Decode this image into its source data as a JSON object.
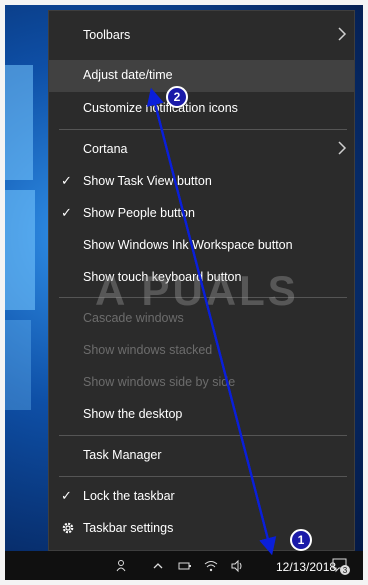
{
  "menu": {
    "items": [
      {
        "label": "Toolbars",
        "submenu": true
      },
      {
        "label": "Adjust date/time",
        "hover": true
      },
      {
        "label": "Customize notification icons"
      },
      {
        "label": "Cortana",
        "submenu": true
      },
      {
        "label": "Show Task View button",
        "checked": true
      },
      {
        "label": "Show People button",
        "checked": true
      },
      {
        "label": "Show Windows Ink Workspace button"
      },
      {
        "label": "Show touch keyboard button"
      },
      {
        "label": "Cascade windows",
        "disabled": true
      },
      {
        "label": "Show windows stacked",
        "disabled": true
      },
      {
        "label": "Show windows side by side",
        "disabled": true
      },
      {
        "label": "Show the desktop"
      },
      {
        "label": "Task Manager"
      },
      {
        "label": "Lock the taskbar",
        "checked": true
      },
      {
        "label": "Taskbar settings",
        "icon": "gear-icon"
      }
    ]
  },
  "taskbar": {
    "clock": "12/13/2018",
    "notification_count": "3",
    "tray_icons": [
      "people-icon",
      "chevron-up-icon",
      "battery-icon",
      "wifi-icon",
      "volume-icon"
    ]
  },
  "watermark": "A PUALS",
  "annotations": {
    "marker_1": "1",
    "marker_2": "2",
    "arrow_color": "#0a1fd9"
  }
}
